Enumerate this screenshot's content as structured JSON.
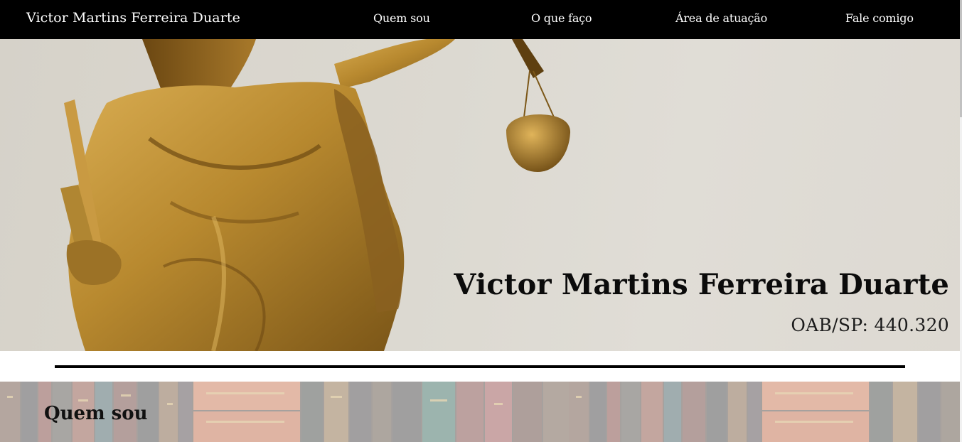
{
  "navbar": {
    "brand": "Victor Martins Ferreira Duarte",
    "links": [
      {
        "label": "Quem sou"
      },
      {
        "label": "O que faço"
      },
      {
        "label": "Área de atuação"
      },
      {
        "label": "Fale comigo"
      }
    ]
  },
  "hero": {
    "title": "Victor Martins Ferreira Duarte",
    "subtitle": "OAB/SP: 440.320"
  },
  "about": {
    "title_light": "Quem",
    "title_bold": "sou"
  },
  "colors": {
    "navbar_bg": "#000000",
    "nav_text": "#ffffff",
    "statue_gold": "#b8892f",
    "hero_bg": "#dcd9d1"
  }
}
